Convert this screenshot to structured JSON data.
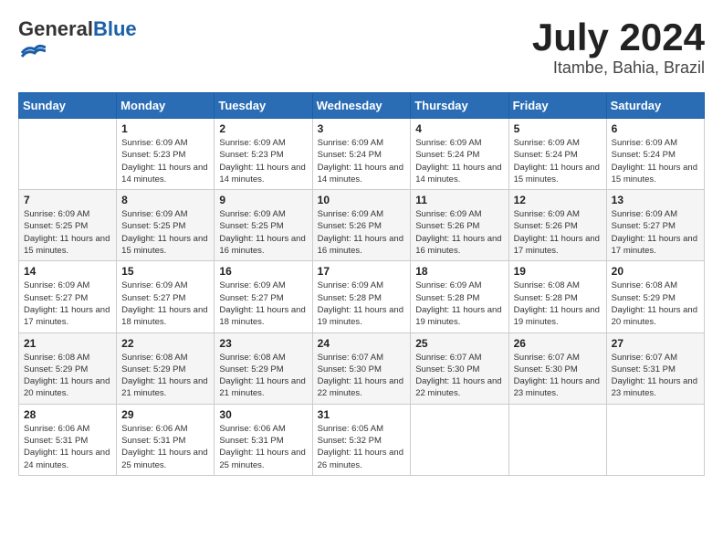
{
  "header": {
    "logo_general": "General",
    "logo_blue": "Blue",
    "month": "July 2024",
    "location": "Itambe, Bahia, Brazil"
  },
  "days_of_week": [
    "Sunday",
    "Monday",
    "Tuesday",
    "Wednesday",
    "Thursday",
    "Friday",
    "Saturday"
  ],
  "weeks": [
    [
      {
        "day": "",
        "sunrise": "",
        "sunset": "",
        "daylight": ""
      },
      {
        "day": "1",
        "sunrise": "Sunrise: 6:09 AM",
        "sunset": "Sunset: 5:23 PM",
        "daylight": "Daylight: 11 hours and 14 minutes."
      },
      {
        "day": "2",
        "sunrise": "Sunrise: 6:09 AM",
        "sunset": "Sunset: 5:23 PM",
        "daylight": "Daylight: 11 hours and 14 minutes."
      },
      {
        "day": "3",
        "sunrise": "Sunrise: 6:09 AM",
        "sunset": "Sunset: 5:24 PM",
        "daylight": "Daylight: 11 hours and 14 minutes."
      },
      {
        "day": "4",
        "sunrise": "Sunrise: 6:09 AM",
        "sunset": "Sunset: 5:24 PM",
        "daylight": "Daylight: 11 hours and 14 minutes."
      },
      {
        "day": "5",
        "sunrise": "Sunrise: 6:09 AM",
        "sunset": "Sunset: 5:24 PM",
        "daylight": "Daylight: 11 hours and 15 minutes."
      },
      {
        "day": "6",
        "sunrise": "Sunrise: 6:09 AM",
        "sunset": "Sunset: 5:24 PM",
        "daylight": "Daylight: 11 hours and 15 minutes."
      }
    ],
    [
      {
        "day": "7",
        "sunrise": "Sunrise: 6:09 AM",
        "sunset": "Sunset: 5:25 PM",
        "daylight": "Daylight: 11 hours and 15 minutes."
      },
      {
        "day": "8",
        "sunrise": "Sunrise: 6:09 AM",
        "sunset": "Sunset: 5:25 PM",
        "daylight": "Daylight: 11 hours and 15 minutes."
      },
      {
        "day": "9",
        "sunrise": "Sunrise: 6:09 AM",
        "sunset": "Sunset: 5:25 PM",
        "daylight": "Daylight: 11 hours and 16 minutes."
      },
      {
        "day": "10",
        "sunrise": "Sunrise: 6:09 AM",
        "sunset": "Sunset: 5:26 PM",
        "daylight": "Daylight: 11 hours and 16 minutes."
      },
      {
        "day": "11",
        "sunrise": "Sunrise: 6:09 AM",
        "sunset": "Sunset: 5:26 PM",
        "daylight": "Daylight: 11 hours and 16 minutes."
      },
      {
        "day": "12",
        "sunrise": "Sunrise: 6:09 AM",
        "sunset": "Sunset: 5:26 PM",
        "daylight": "Daylight: 11 hours and 17 minutes."
      },
      {
        "day": "13",
        "sunrise": "Sunrise: 6:09 AM",
        "sunset": "Sunset: 5:27 PM",
        "daylight": "Daylight: 11 hours and 17 minutes."
      }
    ],
    [
      {
        "day": "14",
        "sunrise": "Sunrise: 6:09 AM",
        "sunset": "Sunset: 5:27 PM",
        "daylight": "Daylight: 11 hours and 17 minutes."
      },
      {
        "day": "15",
        "sunrise": "Sunrise: 6:09 AM",
        "sunset": "Sunset: 5:27 PM",
        "daylight": "Daylight: 11 hours and 18 minutes."
      },
      {
        "day": "16",
        "sunrise": "Sunrise: 6:09 AM",
        "sunset": "Sunset: 5:27 PM",
        "daylight": "Daylight: 11 hours and 18 minutes."
      },
      {
        "day": "17",
        "sunrise": "Sunrise: 6:09 AM",
        "sunset": "Sunset: 5:28 PM",
        "daylight": "Daylight: 11 hours and 19 minutes."
      },
      {
        "day": "18",
        "sunrise": "Sunrise: 6:09 AM",
        "sunset": "Sunset: 5:28 PM",
        "daylight": "Daylight: 11 hours and 19 minutes."
      },
      {
        "day": "19",
        "sunrise": "Sunrise: 6:08 AM",
        "sunset": "Sunset: 5:28 PM",
        "daylight": "Daylight: 11 hours and 19 minutes."
      },
      {
        "day": "20",
        "sunrise": "Sunrise: 6:08 AM",
        "sunset": "Sunset: 5:29 PM",
        "daylight": "Daylight: 11 hours and 20 minutes."
      }
    ],
    [
      {
        "day": "21",
        "sunrise": "Sunrise: 6:08 AM",
        "sunset": "Sunset: 5:29 PM",
        "daylight": "Daylight: 11 hours and 20 minutes."
      },
      {
        "day": "22",
        "sunrise": "Sunrise: 6:08 AM",
        "sunset": "Sunset: 5:29 PM",
        "daylight": "Daylight: 11 hours and 21 minutes."
      },
      {
        "day": "23",
        "sunrise": "Sunrise: 6:08 AM",
        "sunset": "Sunset: 5:29 PM",
        "daylight": "Daylight: 11 hours and 21 minutes."
      },
      {
        "day": "24",
        "sunrise": "Sunrise: 6:07 AM",
        "sunset": "Sunset: 5:30 PM",
        "daylight": "Daylight: 11 hours and 22 minutes."
      },
      {
        "day": "25",
        "sunrise": "Sunrise: 6:07 AM",
        "sunset": "Sunset: 5:30 PM",
        "daylight": "Daylight: 11 hours and 22 minutes."
      },
      {
        "day": "26",
        "sunrise": "Sunrise: 6:07 AM",
        "sunset": "Sunset: 5:30 PM",
        "daylight": "Daylight: 11 hours and 23 minutes."
      },
      {
        "day": "27",
        "sunrise": "Sunrise: 6:07 AM",
        "sunset": "Sunset: 5:31 PM",
        "daylight": "Daylight: 11 hours and 23 minutes."
      }
    ],
    [
      {
        "day": "28",
        "sunrise": "Sunrise: 6:06 AM",
        "sunset": "Sunset: 5:31 PM",
        "daylight": "Daylight: 11 hours and 24 minutes."
      },
      {
        "day": "29",
        "sunrise": "Sunrise: 6:06 AM",
        "sunset": "Sunset: 5:31 PM",
        "daylight": "Daylight: 11 hours and 25 minutes."
      },
      {
        "day": "30",
        "sunrise": "Sunrise: 6:06 AM",
        "sunset": "Sunset: 5:31 PM",
        "daylight": "Daylight: 11 hours and 25 minutes."
      },
      {
        "day": "31",
        "sunrise": "Sunrise: 6:05 AM",
        "sunset": "Sunset: 5:32 PM",
        "daylight": "Daylight: 11 hours and 26 minutes."
      },
      {
        "day": "",
        "sunrise": "",
        "sunset": "",
        "daylight": ""
      },
      {
        "day": "",
        "sunrise": "",
        "sunset": "",
        "daylight": ""
      },
      {
        "day": "",
        "sunrise": "",
        "sunset": "",
        "daylight": ""
      }
    ]
  ]
}
